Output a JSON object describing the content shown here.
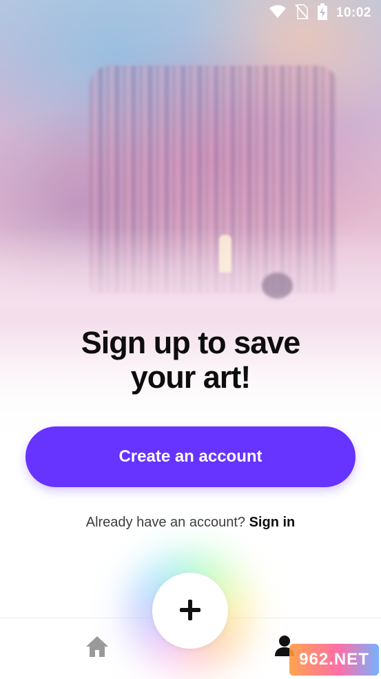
{
  "status_bar": {
    "time": "10:02",
    "icons": [
      "wifi-icon",
      "no-sim-icon",
      "battery-charging-icon"
    ]
  },
  "hero": {
    "title_line1": "Sign up to save",
    "title_line2": "your art!"
  },
  "cta": {
    "label": "Create an account",
    "color": "#6633ff"
  },
  "signin": {
    "prompt": "Already have an account?",
    "link": "Sign in"
  },
  "bottom_nav": {
    "items": [
      "home-icon",
      "plus-icon",
      "profile-icon"
    ]
  },
  "watermark": {
    "text": "962.NET"
  }
}
